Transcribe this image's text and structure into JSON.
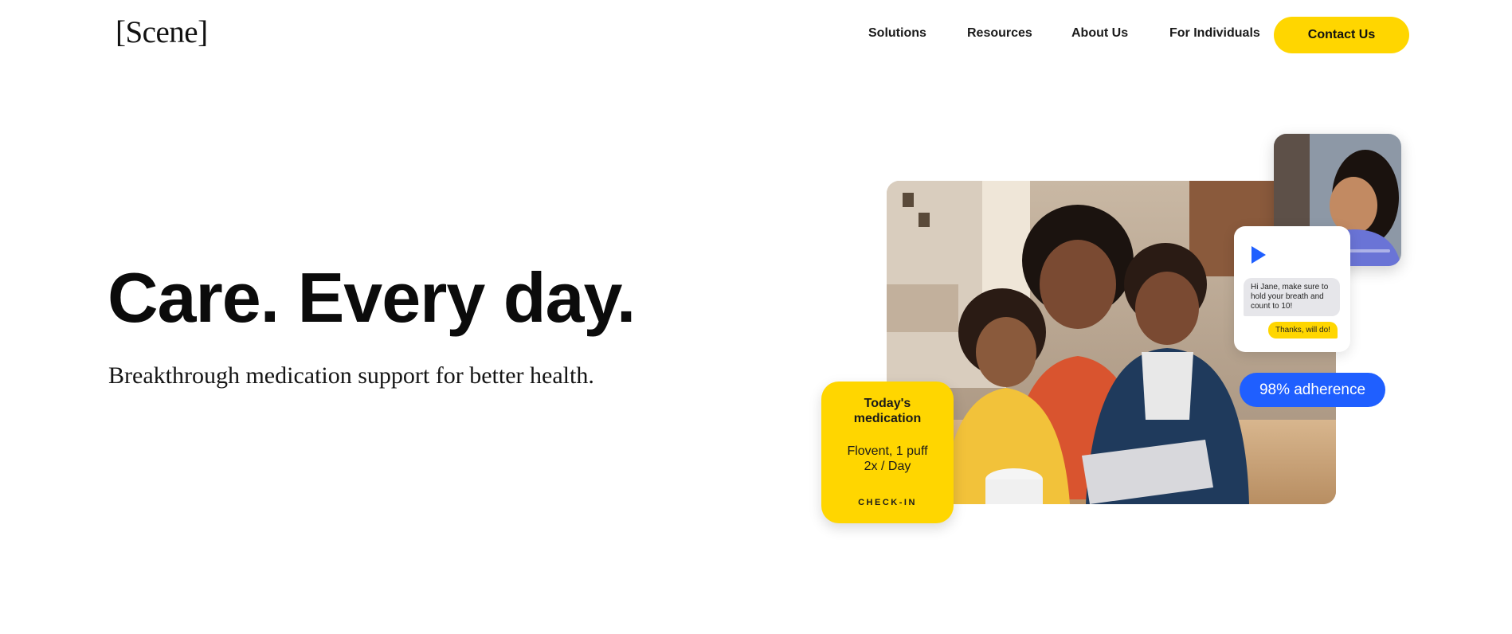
{
  "header": {
    "logo": "[Scene]",
    "nav": [
      "Solutions",
      "Resources",
      "About Us",
      "For Individuals"
    ],
    "contact_label": "Contact Us"
  },
  "hero": {
    "title": "Care. Every day.",
    "subtitle": "Breakthrough medication support for better health."
  },
  "med_card": {
    "title": "Today's medication",
    "dose": "Flovent, 1 puff 2x / Day",
    "action": "CHECK-IN"
  },
  "chat": {
    "incoming": "Hi Jane, make sure to hold your breath and count to 10!",
    "outgoing": "Thanks, will do!"
  },
  "video": {
    "progress": 0.45
  },
  "adherence_badge": "98% adherence",
  "colors": {
    "brand_yellow": "#ffd600",
    "accent_blue": "#1f5fff",
    "text": "#111111"
  }
}
